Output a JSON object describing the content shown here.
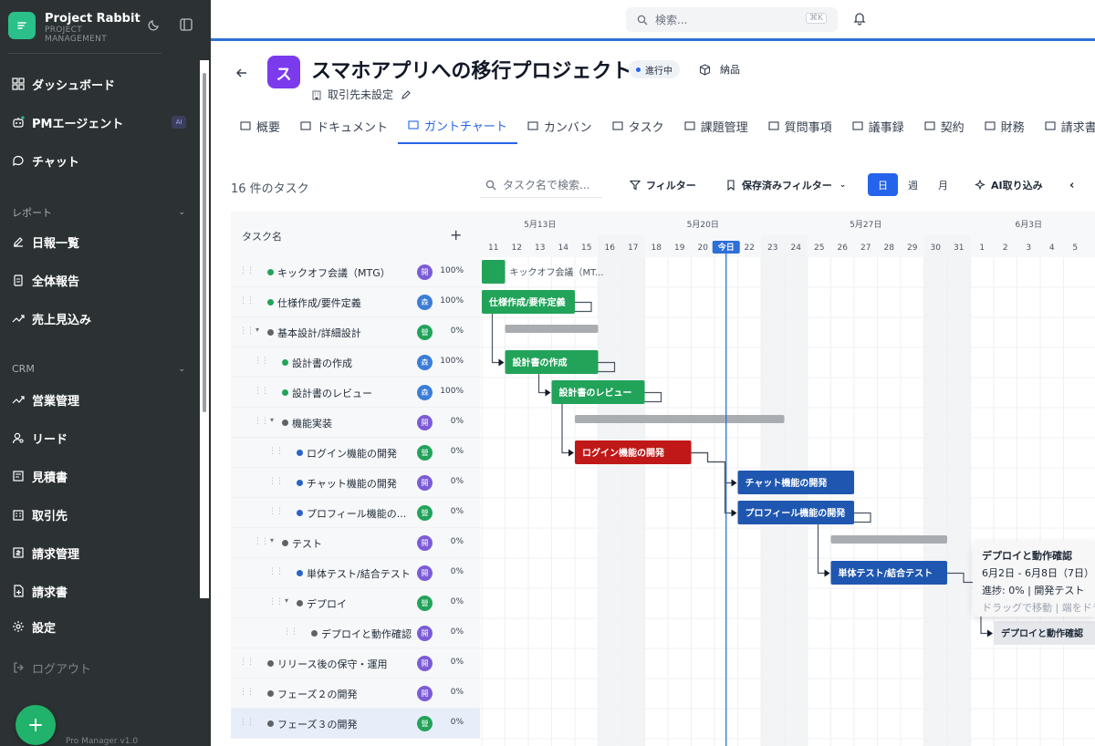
{
  "app": {
    "name": "Project Rabbit",
    "subtitle": "PROJECT MANAGEMENT",
    "version": "Pro Manager v1.0"
  },
  "sidebar": {
    "items_top": [
      {
        "label": "ダッシュボード",
        "icon": "dashboard-icon"
      },
      {
        "label": "PMエージェント",
        "icon": "robot-icon",
        "badge": "AI"
      },
      {
        "label": "チャット",
        "icon": "chat-icon"
      }
    ],
    "section_report": "レポート",
    "items_report": [
      {
        "label": "日報一覧",
        "icon": "edit-icon"
      },
      {
        "label": "全体報告",
        "icon": "clipboard-icon"
      },
      {
        "label": "売上見込み",
        "icon": "trend-icon"
      }
    ],
    "section_crm": "CRM",
    "items_crm": [
      {
        "label": "営業管理",
        "icon": "trend-icon"
      },
      {
        "label": "リード",
        "icon": "user-search-icon"
      },
      {
        "label": "見積書",
        "icon": "quote-icon"
      },
      {
        "label": "取引先",
        "icon": "building-icon"
      },
      {
        "label": "請求管理",
        "icon": "invoice-icon"
      },
      {
        "label": "請求書",
        "icon": "file-plus-icon"
      },
      {
        "label": "設定",
        "icon": "gear-icon"
      }
    ],
    "logout": "ログアウト"
  },
  "topbar": {
    "search_placeholder": "検索...",
    "shortcut": "⌘K"
  },
  "project": {
    "avatar": "ス",
    "title": "スマホアプリへの移行プロジェクト",
    "status": "進行中",
    "delivery": "納品",
    "client": "取引先未設定"
  },
  "tabs": [
    {
      "label": "概要",
      "icon": "chart-icon"
    },
    {
      "label": "ドキュメント",
      "icon": "book-icon"
    },
    {
      "label": "ガントチャート",
      "icon": "gantt-icon",
      "active": true
    },
    {
      "label": "カンバン",
      "icon": "grid-icon"
    },
    {
      "label": "タスク",
      "icon": "list-icon"
    },
    {
      "label": "課題管理",
      "icon": "warning-icon"
    },
    {
      "label": "質問事項",
      "icon": "question-icon"
    },
    {
      "label": "議事録",
      "icon": "doc-icon"
    },
    {
      "label": "契約",
      "icon": "contract-icon"
    },
    {
      "label": "財務",
      "icon": "wallet-icon"
    },
    {
      "label": "請求書",
      "icon": "receipt-icon"
    }
  ],
  "toolbar": {
    "task_count": "16 件のタスク",
    "search_placeholder": "タスク名で検索...",
    "filter": "フィルター",
    "saved_filter": "保存済みフィルター",
    "views": [
      "日",
      "週",
      "月"
    ],
    "active_view": "日",
    "ai_import": "AI取り込み"
  },
  "task_list": {
    "header": "タスク名",
    "tasks": [
      {
        "name": "キックオフ会議（MTG）",
        "level": 0,
        "group": false,
        "color": "#22a35a",
        "assignee": "開",
        "assignee_color": "#7c5cd6",
        "progress": "100%"
      },
      {
        "name": "仕様作成/要件定義",
        "level": 0,
        "group": false,
        "color": "#22a35a",
        "assignee": "森",
        "assignee_color": "#3b7dd8",
        "progress": "100%"
      },
      {
        "name": "基本設計/詳細設計",
        "level": 0,
        "group": true,
        "color": "#5f6368",
        "assignee": "營",
        "assignee_color": "#22a35a",
        "progress": "0%"
      },
      {
        "name": "設計書の作成",
        "level": 1,
        "group": false,
        "color": "#22a35a",
        "assignee": "森",
        "assignee_color": "#3b7dd8",
        "progress": "100%"
      },
      {
        "name": "設計書のレビュー",
        "level": 1,
        "group": false,
        "color": "#22a35a",
        "assignee": "森",
        "assignee_color": "#3b7dd8",
        "progress": "100%"
      },
      {
        "name": "機能実装",
        "level": 1,
        "group": true,
        "color": "#5f6368",
        "assignee": "開",
        "assignee_color": "#7c5cd6",
        "progress": "0%"
      },
      {
        "name": "ログイン機能の開発",
        "level": 2,
        "group": false,
        "color": "#2a63c9",
        "assignee": "營",
        "assignee_color": "#22a35a",
        "progress": "0%"
      },
      {
        "name": "チャット機能の開発",
        "level": 2,
        "group": false,
        "color": "#2a63c9",
        "assignee": "開",
        "assignee_color": "#7c5cd6",
        "progress": "0%"
      },
      {
        "name": "プロフィール機能の...",
        "level": 2,
        "group": false,
        "color": "#2a63c9",
        "assignee": "營",
        "assignee_color": "#22a35a",
        "progress": "0%"
      },
      {
        "name": "テスト",
        "level": 1,
        "group": true,
        "color": "#5f6368",
        "assignee": "開",
        "assignee_color": "#7c5cd6",
        "progress": "0%"
      },
      {
        "name": "単体テスト/結合テスト",
        "level": 2,
        "group": false,
        "color": "#2a63c9",
        "assignee": "開",
        "assignee_color": "#7c5cd6",
        "progress": "0%"
      },
      {
        "name": "デプロイ",
        "level": 2,
        "group": true,
        "color": "#5f6368",
        "assignee": "營",
        "assignee_color": "#22a35a",
        "progress": "0%"
      },
      {
        "name": "デプロイと動作確認",
        "level": 3,
        "group": false,
        "color": "#5f6368",
        "assignee": "開",
        "assignee_color": "#7c5cd6",
        "progress": "0%"
      },
      {
        "name": "リリース後の保守・運用",
        "level": 0,
        "group": false,
        "color": "#5f6368",
        "assignee": "開",
        "assignee_color": "#7c5cd6",
        "progress": "0%"
      },
      {
        "name": "フェーズ２の開発",
        "level": 0,
        "group": false,
        "color": "#5f6368",
        "assignee": "開",
        "assignee_color": "#7c5cd6",
        "progress": "0%"
      },
      {
        "name": "フェーズ３の開発",
        "level": 0,
        "group": false,
        "color": "#5f6368",
        "assignee": "營",
        "assignee_color": "#22a35a",
        "progress": "0%",
        "selected": true
      }
    ]
  },
  "gantt": {
    "week_labels": [
      {
        "label": "5月13日",
        "day_index": 2
      },
      {
        "label": "5月20日",
        "day_index": 9
      },
      {
        "label": "5月27日",
        "day_index": 16
      },
      {
        "label": "6月3日",
        "day_index": 23
      }
    ],
    "days": [
      "11",
      "12",
      "13",
      "14",
      "15",
      "16",
      "17",
      "18",
      "19",
      "20",
      "21",
      "22",
      "23",
      "24",
      "25",
      "26",
      "27",
      "28",
      "29",
      "30",
      "31",
      "1",
      "2",
      "3",
      "4",
      "5"
    ],
    "weekend_indices": [
      5,
      6,
      12,
      13,
      19,
      20
    ],
    "today_label": "今日",
    "today_index": 10,
    "bars": [
      {
        "row": 0,
        "start": 0,
        "end": 1,
        "label": "キックオフ会議（MT...",
        "label_outside": true,
        "color": "#22a35a"
      },
      {
        "row": 1,
        "start": 0,
        "end": 4,
        "label": "仕様作成/要件定義",
        "color": "#22a35a"
      },
      {
        "row": 2,
        "start": 1,
        "end": 5,
        "label": "",
        "summary": true
      },
      {
        "row": 3,
        "start": 1,
        "end": 5,
        "label": "設計書の作成",
        "color": "#22a35a"
      },
      {
        "row": 4,
        "start": 3,
        "end": 7,
        "label": "設計書のレビュー",
        "color": "#22a35a"
      },
      {
        "row": 5,
        "start": 4,
        "end": 13,
        "label": "",
        "summary": true
      },
      {
        "row": 6,
        "start": 4,
        "end": 9,
        "label": "ログイン機能の開発",
        "color": "#c01818"
      },
      {
        "row": 7,
        "start": 11,
        "end": 16,
        "label": "チャット機能の開発",
        "color": "#1f57b0"
      },
      {
        "row": 8,
        "start": 11,
        "end": 16,
        "label": "プロフィール機能の開発",
        "color": "#1f57b0"
      },
      {
        "row": 9,
        "start": 15,
        "end": 20,
        "label": "",
        "summary": true
      },
      {
        "row": 10,
        "start": 15,
        "end": 20,
        "label": "単体テスト/結合テスト",
        "color": "#1f57b0"
      },
      {
        "row": 12,
        "start": 22,
        "end": 27,
        "label": "デプロイと動作確認",
        "color": "#e5e7eb",
        "dark_text": true
      }
    ],
    "links": [
      [
        1,
        3
      ],
      [
        3,
        4
      ],
      [
        4,
        6
      ],
      [
        6,
        7
      ],
      [
        6,
        8
      ],
      [
        8,
        10
      ],
      [
        10,
        12
      ]
    ]
  },
  "tooltip": {
    "title": "デプロイと動作確認",
    "dates": "6月2日 - 6月8日（7日）",
    "progress": "進捗: 0% | 開発テスト",
    "hint": "ドラッグで移動 | 端をドラッグで期間変更"
  }
}
